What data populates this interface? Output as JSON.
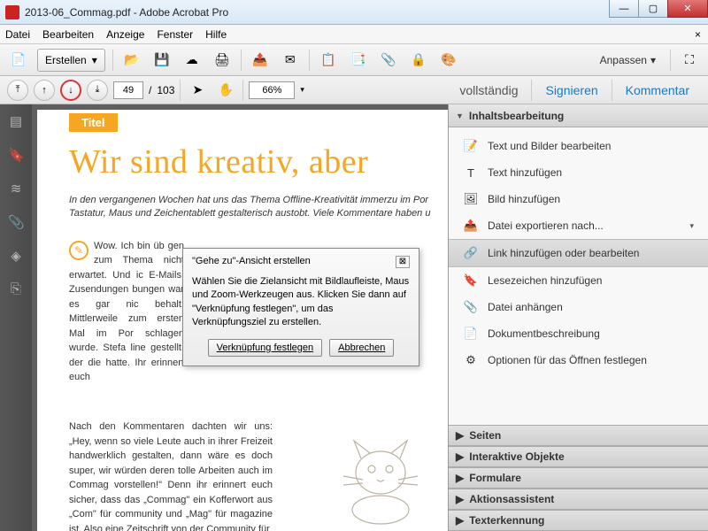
{
  "window": {
    "title": "2013-06_Commag.pdf - Adobe Acrobat Pro"
  },
  "menu": {
    "items": [
      "Datei",
      "Bearbeiten",
      "Anzeige",
      "Fenster",
      "Hilfe"
    ]
  },
  "toolbar1": {
    "create_label": "Erstellen",
    "anpassen_label": "Anpassen"
  },
  "toolbar2": {
    "page_current": "49",
    "page_total": "103",
    "page_sep": "/",
    "zoom": "66%",
    "tabs": {
      "voll": "vollständig",
      "sign": "Signieren",
      "kom": "Kommentar"
    }
  },
  "document": {
    "label": "Titel",
    "headline": "Wir sind kreativ, aber",
    "intro": "In den vergangenen Wochen hat uns das Thema Offline-Kreativität immerzu im Por\nTastatur, Maus und Zeichentablett gestalterisch austobt. Viele Kommentare haben u",
    "col1": "Wow. Ich bin üb\ngen zum Thema\nnicht erwartet. Und ic\nE-Mails, Zusendungen\nbungen war es gar nic\nbehalt. Mittlerweile\nzum ersten Mal im Por\nschlagen wurde. Stefa\nline gestellt, der die\nhatte. Ihr erinnert euch",
    "col2": "Nach den Kommentaren dachten wir uns: „Hey, wenn so viele Leute auch in ihrer Freizeit handwerklich gestalten, dann wäre es doch super, wir würden deren tolle Arbeiten auch im Commag vorstellen!\" Denn ihr erinnert euch sicher, dass das „Commag\" ein Kofferwort aus „Com\" für community und „Mag\" für magazine ist. Also eine Zeitschrift von der Community für"
  },
  "dialog": {
    "title": "\"Gehe zu\"-Ansicht erstellen",
    "body": "Wählen Sie die Zielansicht mit Bildlaufleiste, Maus und Zoom-Werkzeugen aus. Klicken Sie dann auf \"Verknüpfung festlegen\", um das Verknüpfungsziel zu erstellen.",
    "ok": "Verknüpfung festlegen",
    "cancel": "Abbrechen"
  },
  "rightpanel": {
    "header": "Inhaltsbearbeitung",
    "items": [
      {
        "label": "Text und Bilder bearbeiten",
        "icon": "📝"
      },
      {
        "label": "Text hinzufügen",
        "icon": "T"
      },
      {
        "label": "Bild hinzufügen",
        "icon": "🖼"
      },
      {
        "label": "Datei exportieren nach...",
        "icon": "📤",
        "submenu": true
      },
      {
        "label": "Link hinzufügen oder bearbeiten",
        "icon": "🔗",
        "selected": true
      },
      {
        "label": "Lesezeichen hinzufügen",
        "icon": "🔖"
      },
      {
        "label": "Datei anhängen",
        "icon": "📎"
      },
      {
        "label": "Dokumentbeschreibung",
        "icon": "📄"
      },
      {
        "label": "Optionen für das Öffnen festlegen",
        "icon": "⚙"
      }
    ],
    "sections": [
      "Seiten",
      "Interaktive Objekte",
      "Formulare",
      "Aktionsassistent",
      "Texterkennung"
    ]
  }
}
